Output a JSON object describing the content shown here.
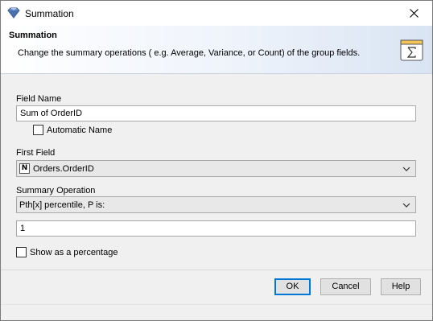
{
  "window": {
    "title": "Summation"
  },
  "banner": {
    "title": "Summation",
    "description": "Change the summary operations ( e.g. Average, Variance, or Count) of the group fields."
  },
  "form": {
    "field_name_label": "Field Name",
    "field_name_value": "Sum of OrderID",
    "automatic_name_label": "Automatic Name",
    "automatic_name_checked": false,
    "first_field_label": "First Field",
    "first_field_icon_letter": "N",
    "first_field_value": "Orders.OrderID",
    "summary_operation_label": "Summary Operation",
    "summary_operation_value": "Pth[x] percentile, P is:",
    "parameter_value": "1",
    "show_percentage_label": "Show as a percentage",
    "show_percentage_checked": false
  },
  "buttons": {
    "ok": "OK",
    "cancel": "Cancel",
    "help": "Help"
  },
  "colors": {
    "accent": "#0078d7",
    "banner_end": "#d9e4f3"
  }
}
